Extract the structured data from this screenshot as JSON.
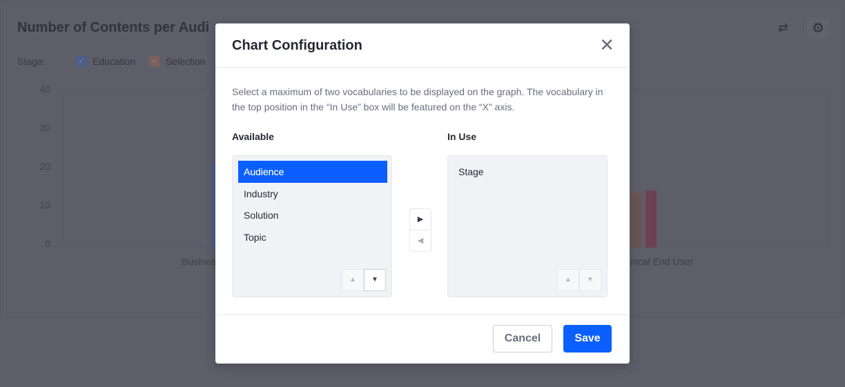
{
  "background": {
    "title": "Number of Contents per Audi",
    "legend_label": "Stage:",
    "legend": [
      {
        "label": "Education",
        "color": "#4b5f8a",
        "checked": true
      },
      {
        "label": "Selection",
        "color": "#7a5f5c",
        "checked": true
      }
    ],
    "y_ticks": [
      "40",
      "30",
      "20",
      "10",
      "0"
    ],
    "x_labels": [
      "Busines",
      "nical End User"
    ],
    "icons": [
      "swap-icon",
      "gear-icon"
    ]
  },
  "chart_data": {
    "type": "bar",
    "ylim": [
      0,
      40
    ],
    "y_ticks": [
      0,
      10,
      20,
      30,
      40
    ],
    "categories": [
      "Busines",
      "nical End User"
    ],
    "visible_bars": [
      {
        "category": "Busines",
        "series": "Education",
        "value": 21.5,
        "color": "#4b5f8a"
      },
      {
        "category": "nical End User",
        "series": "Selection",
        "value": 14,
        "color": "#6a5556"
      },
      {
        "category": "nical End User",
        "series": "",
        "value": 14.5,
        "color": "#6c4150"
      }
    ]
  },
  "modal": {
    "title": "Chart Configuration",
    "description": "Select a maximum of two vocabularies to be displayed on the graph. The vocabulary in the top position in the “In Use” box will be featured on the “X” axis.",
    "available_label": "Available",
    "in_use_label": "In Use",
    "available": [
      "Audience",
      "Industry",
      "Solution",
      "Topic"
    ],
    "selected_available": "Audience",
    "in_use": [
      "Stage"
    ],
    "cancel": "Cancel",
    "save": "Save",
    "accent": "#0b5fff"
  }
}
